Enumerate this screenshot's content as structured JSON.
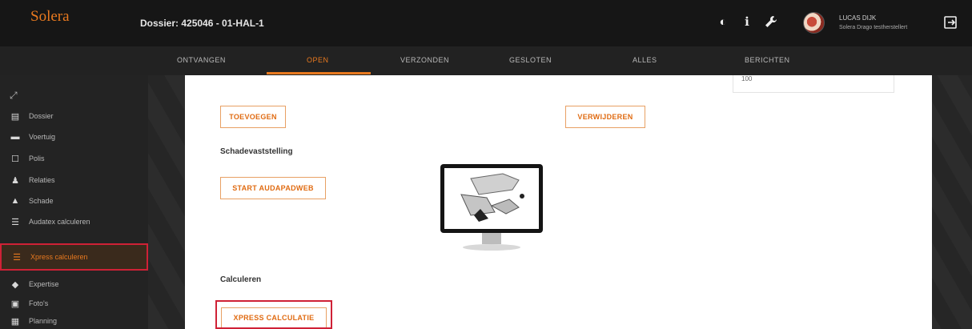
{
  "header": {
    "logo": "Solera",
    "dossier": "Dossier: 425046 - 01-HAL-1",
    "icons": [
      "contrast-icon",
      "info-icon",
      "wrench-icon"
    ],
    "user_name": "LUCAS DIJK",
    "user_company": "Solera Drago testherstellert",
    "accent": "#e8791f"
  },
  "tabs": [
    {
      "label": "ONTVANGEN",
      "active": false
    },
    {
      "label": "OPEN",
      "active": true
    },
    {
      "label": "VERZONDEN",
      "active": false
    },
    {
      "label": "GESLOTEN",
      "active": false
    },
    {
      "label": "ALLES",
      "active": false
    },
    {
      "label": "BERICHTEN",
      "active": false
    }
  ],
  "sidebar": {
    "items": [
      {
        "label": "Dossier",
        "icon": "clipboard-icon"
      },
      {
        "label": "Voertuig",
        "icon": "car-icon"
      },
      {
        "label": "Polis",
        "icon": "document-icon"
      },
      {
        "label": "Relaties",
        "icon": "people-icon"
      },
      {
        "label": "Schade",
        "icon": "warning-icon"
      },
      {
        "label": "Audatex calculeren",
        "icon": "calculator-icon"
      },
      {
        "label": "Xpress calculeren",
        "icon": "calculator-icon",
        "active": true
      },
      {
        "label": "Expertise",
        "icon": "graduation-icon"
      },
      {
        "label": "Foto's",
        "icon": "photo-icon"
      },
      {
        "label": "Planning",
        "icon": "calendar-icon"
      }
    ]
  },
  "main": {
    "field_value": "100",
    "toevoegen": "TOEVOEGEN",
    "verwijderen": "VERWIJDEREN",
    "schade_title": "Schadevaststelling",
    "start_audapad": "START AUDAPADWEB",
    "calc_title": "Calculeren",
    "xpress_button": "XPRESS CALCULATIE"
  }
}
